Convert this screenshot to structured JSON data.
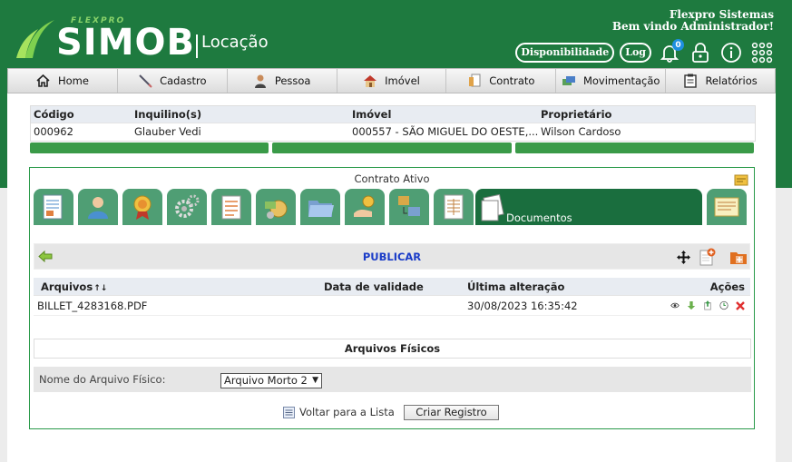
{
  "brand": {
    "prefix": "FLEXPRO",
    "name": "SIMOB",
    "module": "Locação"
  },
  "header": {
    "company": "Flexpro Sistemas",
    "welcome": "Bem vindo Administrador!"
  },
  "tools": {
    "availability": "Disponibilidade",
    "log": "Log",
    "notification_count": "0"
  },
  "nav": [
    {
      "label": "Home",
      "icon": "home-icon"
    },
    {
      "label": "Cadastro",
      "icon": "pencil-icon"
    },
    {
      "label": "Pessoa",
      "icon": "person-icon"
    },
    {
      "label": "Imóvel",
      "icon": "house-icon"
    },
    {
      "label": "Contrato",
      "icon": "contract-icon"
    },
    {
      "label": "Movimentação",
      "icon": "money-icon"
    },
    {
      "label": "Relatórios",
      "icon": "clipboard-icon"
    }
  ],
  "summary": {
    "headers": {
      "code": "Código",
      "tenant": "Inquilino(s)",
      "property": "Imóvel",
      "owner": "Proprietário"
    },
    "row": {
      "code": "000962",
      "tenant": "Glauber Vedi",
      "property": "000557 - SÃO MIGUEL DO OESTE,...",
      "owner": "Wilson Cardoso"
    }
  },
  "panel": {
    "title": "Contrato Ativo",
    "active_tab": "Documentos"
  },
  "toolbar": {
    "title": "PUBLICAR"
  },
  "files": {
    "headers": {
      "name": "Arquivos",
      "validity": "Data de validade",
      "modified": "Última alteração",
      "actions": "Ações"
    },
    "rows": [
      {
        "name": "BILLET_4283168.PDF",
        "validity": "",
        "modified": "30/08/2023 16:35:42"
      }
    ]
  },
  "physical": {
    "title": "Arquivos Físicos",
    "label": "Nome do Arquivo Físico:",
    "selected": "Arquivo Morto 2"
  },
  "footer": {
    "back_label": "Voltar para a Lista",
    "create_label": "Criar Registro"
  },
  "colors": {
    "header_green": "#1e7a3f",
    "tab_green": "#4f9e74",
    "active_tab": "#1a6e3e",
    "progress_green": "#3a9a48",
    "publish_blue": "#1a3cc8"
  }
}
